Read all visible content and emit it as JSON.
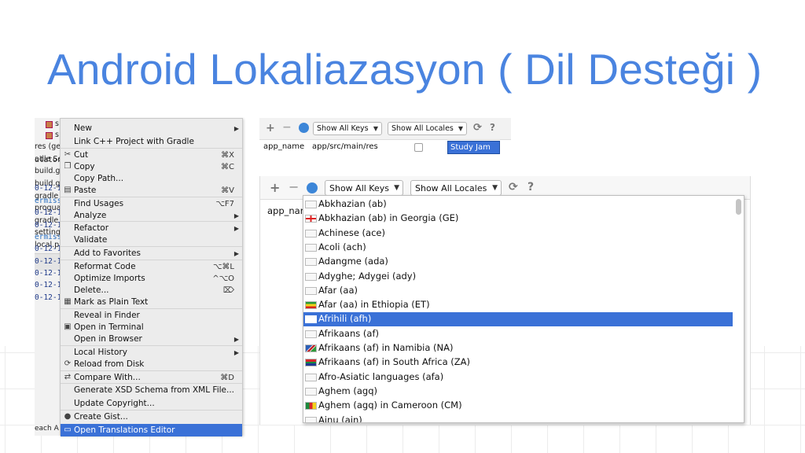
{
  "title": "Android Lokaliazasyon ( Dil Desteği )",
  "ide_files": [
    "s",
    "s",
    "res (ge",
    "adle Sc",
    "build.g",
    "build.g",
    "gradle",
    "progua",
    "gradle",
    "setting",
    "local.p"
  ],
  "ide_logs": [
    {
      "text": "ulator Pix",
      "color": "#222"
    },
    {
      "text": "0-12-1",
      "color": "#1f3a8a"
    },
    {
      "text": "ermissi",
      "color": "#2a6fbf"
    },
    {
      "text": "0-12-1",
      "color": "#1f3a8a"
    },
    {
      "text": "0-12-1",
      "color": "#1f3a8a"
    },
    {
      "text": "ermissi",
      "color": "#2a6fbf"
    },
    {
      "text": "0-12-1",
      "color": "#1f3a8a"
    },
    {
      "text": "0-12-1",
      "color": "#1f3a8a"
    },
    {
      "text": "0-12-1",
      "color": "#1f3a8a"
    },
    {
      "text": "0-12-1",
      "color": "#1f3a8a"
    },
    {
      "text": "0-12-1",
      "color": "#1f3a8a"
    }
  ],
  "ide_bottom": "each A",
  "context_menu": [
    {
      "label": "New",
      "shortcut": "",
      "submenu": true,
      "icon": ""
    },
    {
      "label": "Link C++ Project with Gradle",
      "shortcut": "",
      "submenu": false,
      "icon": ""
    },
    {
      "label": "Cut",
      "shortcut": "⌘X",
      "submenu": false,
      "icon": "scissors-icon"
    },
    {
      "label": "Copy",
      "shortcut": "⌘C",
      "submenu": false,
      "icon": "copy-icon"
    },
    {
      "label": "Copy Path...",
      "shortcut": "",
      "submenu": false,
      "icon": ""
    },
    {
      "label": "Paste",
      "shortcut": "⌘V",
      "submenu": false,
      "icon": "paste-icon"
    },
    {
      "label": "Find Usages",
      "shortcut": "⌥F7",
      "submenu": false,
      "icon": ""
    },
    {
      "label": "Analyze",
      "shortcut": "",
      "submenu": true,
      "icon": ""
    },
    {
      "label": "Refactor",
      "shortcut": "",
      "submenu": true,
      "icon": ""
    },
    {
      "label": "Validate",
      "shortcut": "",
      "submenu": false,
      "icon": ""
    },
    {
      "label": "Add to Favorites",
      "shortcut": "",
      "submenu": true,
      "icon": ""
    },
    {
      "label": "Reformat Code",
      "shortcut": "⌥⌘L",
      "submenu": false,
      "icon": ""
    },
    {
      "label": "Optimize Imports",
      "shortcut": "^⌥O",
      "submenu": false,
      "icon": ""
    },
    {
      "label": "Delete...",
      "shortcut": "⌦",
      "submenu": false,
      "icon": ""
    },
    {
      "label": "Mark as Plain Text",
      "shortcut": "",
      "submenu": false,
      "icon": "plain-text-icon"
    },
    {
      "label": "Reveal in Finder",
      "shortcut": "",
      "submenu": false,
      "icon": ""
    },
    {
      "label": "Open in Terminal",
      "shortcut": "",
      "submenu": false,
      "icon": "terminal-icon"
    },
    {
      "label": "Open in Browser",
      "shortcut": "",
      "submenu": true,
      "icon": ""
    },
    {
      "label": "Local History",
      "shortcut": "",
      "submenu": true,
      "icon": ""
    },
    {
      "label": "Reload from Disk",
      "shortcut": "",
      "submenu": false,
      "icon": "reload-icon"
    },
    {
      "label": "Compare With...",
      "shortcut": "⌘D",
      "submenu": false,
      "icon": "compare-icon"
    },
    {
      "label": "Generate XSD Schema from XML File...",
      "shortcut": "",
      "submenu": false,
      "icon": ""
    },
    {
      "label": "Update Copyright...",
      "shortcut": "",
      "submenu": false,
      "icon": ""
    },
    {
      "label": "Create Gist...",
      "shortcut": "",
      "submenu": false,
      "icon": "github-icon"
    },
    {
      "label": "Open Translations Editor",
      "shortcut": "",
      "submenu": false,
      "icon": "translate-icon"
    }
  ],
  "editor_small": {
    "show_keys": "Show All Keys",
    "show_locales": "Show All Locales",
    "key": "app_name",
    "path": "app/src/main/res",
    "value": "Study Jam"
  },
  "editor_big": {
    "show_keys": "Show All Keys",
    "show_locales": "Show All Locales",
    "key": "app_nar"
  },
  "locales": [
    {
      "label": "Abkhazian (ab)",
      "flag": "blank"
    },
    {
      "label": "Abkhazian (ab) in Georgia (GE)",
      "flag": "georgia"
    },
    {
      "label": "Achinese (ace)",
      "flag": "blank"
    },
    {
      "label": "Acoli (ach)",
      "flag": "blank"
    },
    {
      "label": "Adangme (ada)",
      "flag": "blank"
    },
    {
      "label": "Adyghe; Adygei (ady)",
      "flag": "blank"
    },
    {
      "label": "Afar (aa)",
      "flag": "blank"
    },
    {
      "label": "Afar (aa) in Ethiopia (ET)",
      "flag": "ethiopia"
    },
    {
      "label": "Afrihili (afh)",
      "flag": "blank",
      "selected": true
    },
    {
      "label": "Afrikaans (af)",
      "flag": "blank"
    },
    {
      "label": "Afrikaans (af) in Namibia (NA)",
      "flag": "namibia"
    },
    {
      "label": "Afrikaans (af) in South Africa (ZA)",
      "flag": "southafrica"
    },
    {
      "label": "Afro-Asiatic languages (afa)",
      "flag": "blank"
    },
    {
      "label": "Aghem (agq)",
      "flag": "blank"
    },
    {
      "label": "Aghem (agq) in Cameroon (CM)",
      "flag": "cameroon"
    },
    {
      "label": "Ainu (ain)",
      "flag": "blank"
    }
  ],
  "colors": {
    "title": "#4a84e0",
    "selection": "#3a71d7"
  }
}
